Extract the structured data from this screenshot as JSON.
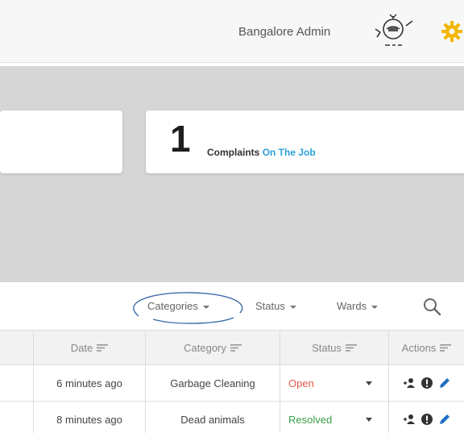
{
  "header": {
    "admin_name": "Bangalore Admin",
    "logo_icon": "municipal-emblem-icon",
    "settings_icon": "gear-icon",
    "gear_color": "#f2b705"
  },
  "stats": {
    "right_card": {
      "number": "1",
      "label_prefix": "Complaints",
      "label_accent": "On The Job",
      "accent_color": "#2d9fd9"
    }
  },
  "filters": {
    "categories_label": "Categories",
    "status_label": "Status",
    "wards_label": "Wards",
    "search_icon": "search-icon"
  },
  "table": {
    "columns": [
      "Date",
      "Category",
      "Status",
      "Actions"
    ],
    "rows": [
      {
        "date": "6 minutes ago",
        "category": "Garbage Cleaning",
        "status": "Open"
      },
      {
        "date": "8 minutes ago",
        "category": "Dead animals",
        "status": "Resolved"
      }
    ],
    "action_icons": [
      "assign-user-icon",
      "alert-icon",
      "edit-pencil-icon"
    ],
    "status_colors": {
      "open": "#e0584c",
      "resolved": "#3aa14a"
    }
  }
}
